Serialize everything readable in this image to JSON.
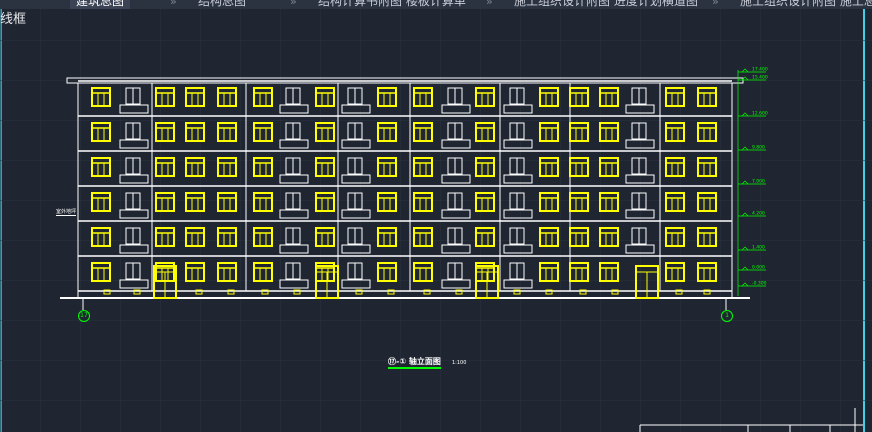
{
  "tabs": [
    {
      "label": "建筑总图",
      "active": true
    },
    {
      "label": "结构总图",
      "active": false
    },
    {
      "label": "结构计算书附图 楼板计算单",
      "active": false
    },
    {
      "label": "施工组织设计附图 进度计划横道图",
      "active": false
    },
    {
      "label": "施工组织设计附图 施工总",
      "active": false
    }
  ],
  "viewport": {
    "view_label": "线框",
    "drawing_title": "⑰-① 轴立面图",
    "drawing_scale": "1:100",
    "left_axis": "17",
    "right_axis": "1",
    "ground_label": "室外地坪",
    "elevations": [
      "17.400",
      "15.400",
      "12.600",
      "9.800",
      "7.000",
      "4.200",
      "1.400",
      "0.000",
      "-0.300"
    ]
  },
  "colors": {
    "background": "#1f2631",
    "window": "#ffff00",
    "line": "#ffffff",
    "axis": "#00ff00",
    "viewport_edge": "#3fd0e8"
  },
  "icons": {
    "tab_separator": "chevron-right-icon"
  }
}
